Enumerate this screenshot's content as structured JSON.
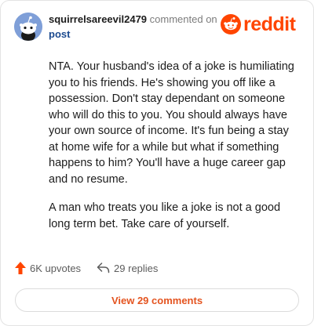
{
  "header": {
    "username": "squirrelsareevil2479",
    "commented_on": "commented on",
    "post_link": "post",
    "logo_text": "reddit"
  },
  "comment": {
    "paragraphs": [
      "NTA. Your husband's idea of a joke is humiliating you to his friends. He's showing you off like a possession. Don't stay dependant on someone who will do this to you. You should always have your own source of income. It's fun being a stay at home wife for a while but what if something happens to him? You'll have a huge career gap and no resume.",
      "A man who treats you like a joke is not a good long term bet. Take care of yourself."
    ]
  },
  "stats": {
    "upvotes": "6K upvotes",
    "replies": "29 replies"
  },
  "footer": {
    "view_comments": "View 29 comments"
  },
  "colors": {
    "brand": "#ff4500",
    "link": "#1c4a8f",
    "view_button_text": "#e45420"
  },
  "icons": {
    "avatar": "snoo-avatar-icon",
    "logo": "reddit-snoo-icon",
    "upvote": "upvote-arrow-icon",
    "reply": "reply-arrow-icon"
  }
}
